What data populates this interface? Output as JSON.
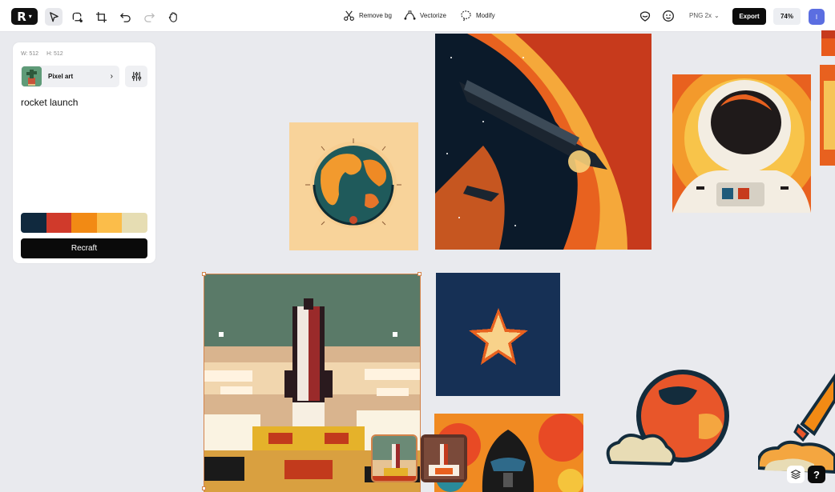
{
  "toolbar": {
    "logo_icon": "recraft-logo-icon",
    "tools": [
      "select-icon",
      "lasso-icon",
      "crop-icon",
      "undo-icon",
      "redo-icon",
      "hand-icon"
    ],
    "remove_bg": "Remove bg",
    "vectorize": "Vectorize",
    "modify": "Modify",
    "format": "PNG 2x",
    "export": "Export",
    "zoom": "74%",
    "user_initial": "I"
  },
  "panel": {
    "width_label": "W: 512",
    "height_label": "H: 512",
    "style_name": "Pixel art",
    "prompt": "rocket launch",
    "palette": [
      "#10293e",
      "#d03a2b",
      "#f28a14",
      "#fbbd4a",
      "#e6ddb3"
    ],
    "generate": "Recraft"
  },
  "colors": {
    "accent_selection": "#d3834a",
    "dark": "#0a0a0a"
  }
}
